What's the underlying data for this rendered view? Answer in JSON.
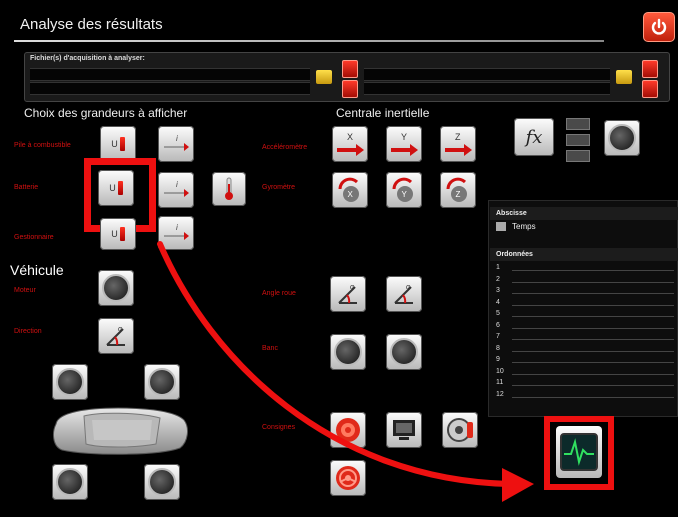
{
  "header": {
    "title": "Analyse des résultats"
  },
  "files": {
    "label": "Fichier(s) d'acquisition à analyser:"
  },
  "sections": {
    "grandeurs": "Choix des grandeurs à afficher",
    "centrale": "Centrale inertielle",
    "vehicule": "Véhicule"
  },
  "labels": {
    "pile": "Pile à combustible",
    "batterie": "Batterie",
    "gestionnaire": "Gestionnaire",
    "moteur": "Moteur",
    "direction": "Direction",
    "accelerometre": "Accéléromètre",
    "gyrometre": "Gyromètre",
    "angle_roue": "Angle roue",
    "banc": "Banc",
    "consignes": "Consignes"
  },
  "buttons": {
    "u": "U",
    "i": "i",
    "alpha": "α",
    "x": "X",
    "y": "Y",
    "z": "Z",
    "fx": "fx"
  },
  "side": {
    "abscisse_label": "Abscisse",
    "abscisse_value": "Temps",
    "ordonnees_label": "Ordonnées",
    "ordonnees": [
      "1",
      "2",
      "3",
      "4",
      "5",
      "6",
      "7",
      "8",
      "9",
      "10",
      "11",
      "12"
    ]
  },
  "colors": {
    "highlight": "#ee1010",
    "label_red": "#d01010"
  }
}
